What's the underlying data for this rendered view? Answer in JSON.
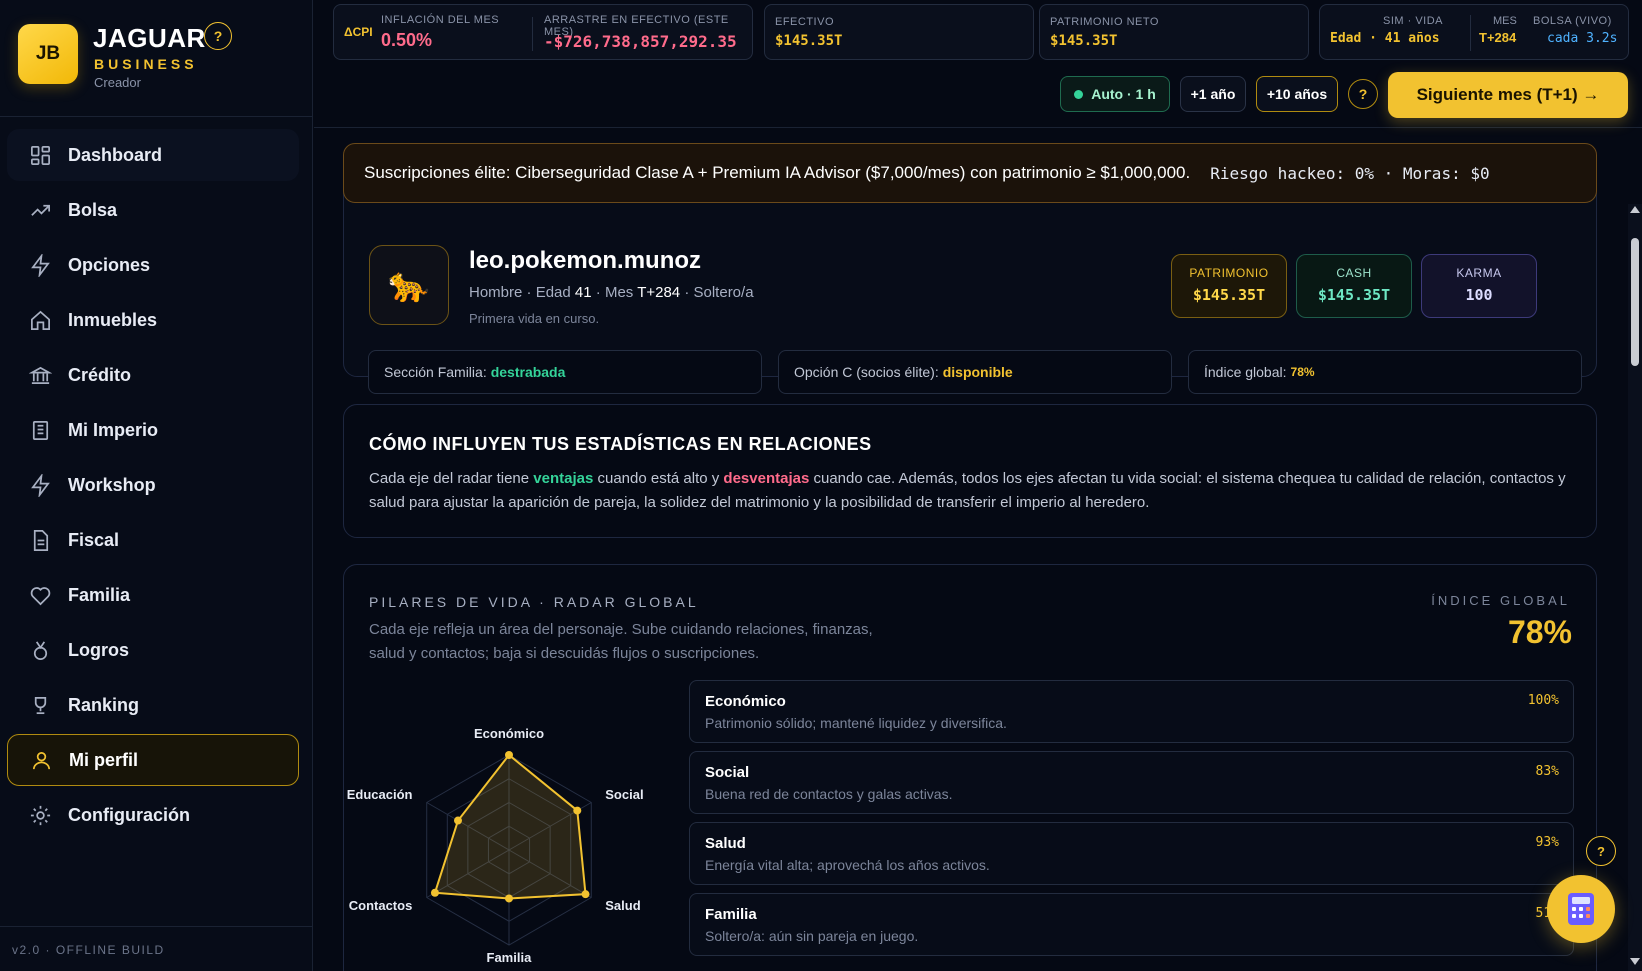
{
  "brand": {
    "initials": "JB",
    "name": "JAGUAR",
    "subtitle": "BUSINESS",
    "role": "Creador",
    "help": "?"
  },
  "nav": [
    {
      "label": "Dashboard",
      "icon": "dashboard-grid-icon"
    },
    {
      "label": "Bolsa",
      "icon": "trend-up-icon"
    },
    {
      "label": "Opciones",
      "icon": "bolt-icon"
    },
    {
      "label": "Inmuebles",
      "icon": "home-icon"
    },
    {
      "label": "Crédito",
      "icon": "bank-icon"
    },
    {
      "label": "Mi Imperio",
      "icon": "building-icon"
    },
    {
      "label": "Workshop",
      "icon": "bolt-icon"
    },
    {
      "label": "Fiscal",
      "icon": "document-icon"
    },
    {
      "label": "Familia",
      "icon": "heart-icon"
    },
    {
      "label": "Logros",
      "icon": "medal-icon"
    },
    {
      "label": "Ranking",
      "icon": "trophy-icon"
    },
    {
      "label": "Mi perfil",
      "icon": "user-icon"
    },
    {
      "label": "Configuración",
      "icon": "gear-icon"
    }
  ],
  "version": "v2.0 · OFFLINE BUILD",
  "topbar": {
    "cpi_tag": "ΔCPI",
    "inflation_label": "INFLACIÓN DEL MES",
    "inflation_value": "0.50%",
    "drag_label": "ARRASTRE EN EFECTIVO (ESTE MES)",
    "drag_value": "-$726,738,857,292.35",
    "efectivo_label": "EFECTIVO",
    "efectivo_value": "$145.35T",
    "neto_label": "PATRIMONIO NETO",
    "neto_value": "$145.35T",
    "sim_label": "SIM · VIDA",
    "sim_value": "Edad · 41 años",
    "mes_label": "MES",
    "mes_value": "T+284",
    "bolsa_label": "BOLSA (VIVO)",
    "bolsa_value": "cada 3.2s"
  },
  "controls": {
    "auto": "Auto · 1 h",
    "plus1": "+1 año",
    "plus10": "+10 años",
    "help": "?",
    "next": "Siguiente mes (T+1) →"
  },
  "banner": {
    "text": "Suscripciones élite: Ciberseguridad Clase A + Premium IA Advisor ($7,000/mes) con patrimonio ≥ $1,000,000.",
    "risk": "Riesgo hackeo: 0% · Moras: $0"
  },
  "profile": {
    "avatar": "🐆",
    "name": "leo.pokemon.munoz",
    "gender": "Hombre",
    "age_label": "Edad",
    "age": "41",
    "month_label": "Mes",
    "month": "T+284",
    "status": "Soltero/a",
    "life": "Primera vida en curso.",
    "patrimonio_label": "PATRIMONIO",
    "patrimonio_value": "$145.35T",
    "cash_label": "CASH",
    "cash_value": "$145.35T",
    "karma_label": "KARMA",
    "karma_value": "100",
    "flag_familia_label": "Sección Familia:",
    "flag_familia_value": "destrabada",
    "flag_opcion_label": "Opción C (socios élite):",
    "flag_opcion_value": "disponible",
    "flag_indice_label": "Índice global:",
    "flag_indice_value": "78%"
  },
  "relations": {
    "title": "CÓMO INFLUYEN TUS ESTADÍSTICAS EN RELACIONES",
    "t1": "Cada eje del radar tiene ",
    "good": "ventajas",
    "t2": " cuando está alto y ",
    "bad": "desventajas",
    "t3": " cuando cae. Además, todos los ejes afectan tu vida social: el sistema chequea tu calidad de relación, contactos y salud para ajustar la aparición de pareja, la solidez del matrimonio y la posibilidad de transferir el imperio al heredero."
  },
  "pillars": {
    "title": "PILARES DE VIDA · RADAR GLOBAL",
    "desc": "Cada eje refleja un área del personaje. Sube cuidando relaciones, finanzas, salud y contactos; baja si descuidás flujos o suscripciones.",
    "index_label": "ÍNDICE GLOBAL",
    "index_value": "78%",
    "items": [
      {
        "name": "Económico",
        "desc": "Patrimonio sólido; mantené liquidez y diversifica.",
        "pct": "100%"
      },
      {
        "name": "Social",
        "desc": "Buena red de contactos y galas activas.",
        "pct": "83%"
      },
      {
        "name": "Salud",
        "desc": "Energía vital alta; aprovechá los años activos.",
        "pct": "93%"
      },
      {
        "name": "Familia",
        "desc": "Soltero/a: aún sin pareja en juego.",
        "pct": "51%"
      }
    ]
  },
  "chart_data": {
    "type": "radar",
    "axes": [
      "Económico",
      "Social",
      "Salud",
      "Familia",
      "Contactos",
      "Educación"
    ],
    "values": [
      100,
      83,
      93,
      51,
      90,
      62
    ],
    "range": [
      0,
      100
    ],
    "rings": 4,
    "color": "#f2c230"
  },
  "floating": {
    "help": "?",
    "calc_icon": "calculator-icon"
  },
  "colors": {
    "accent": "#f2c230",
    "positive": "#34d399",
    "negative": "#ff6b8b",
    "info": "#4fb2ff",
    "background": "#050914"
  }
}
